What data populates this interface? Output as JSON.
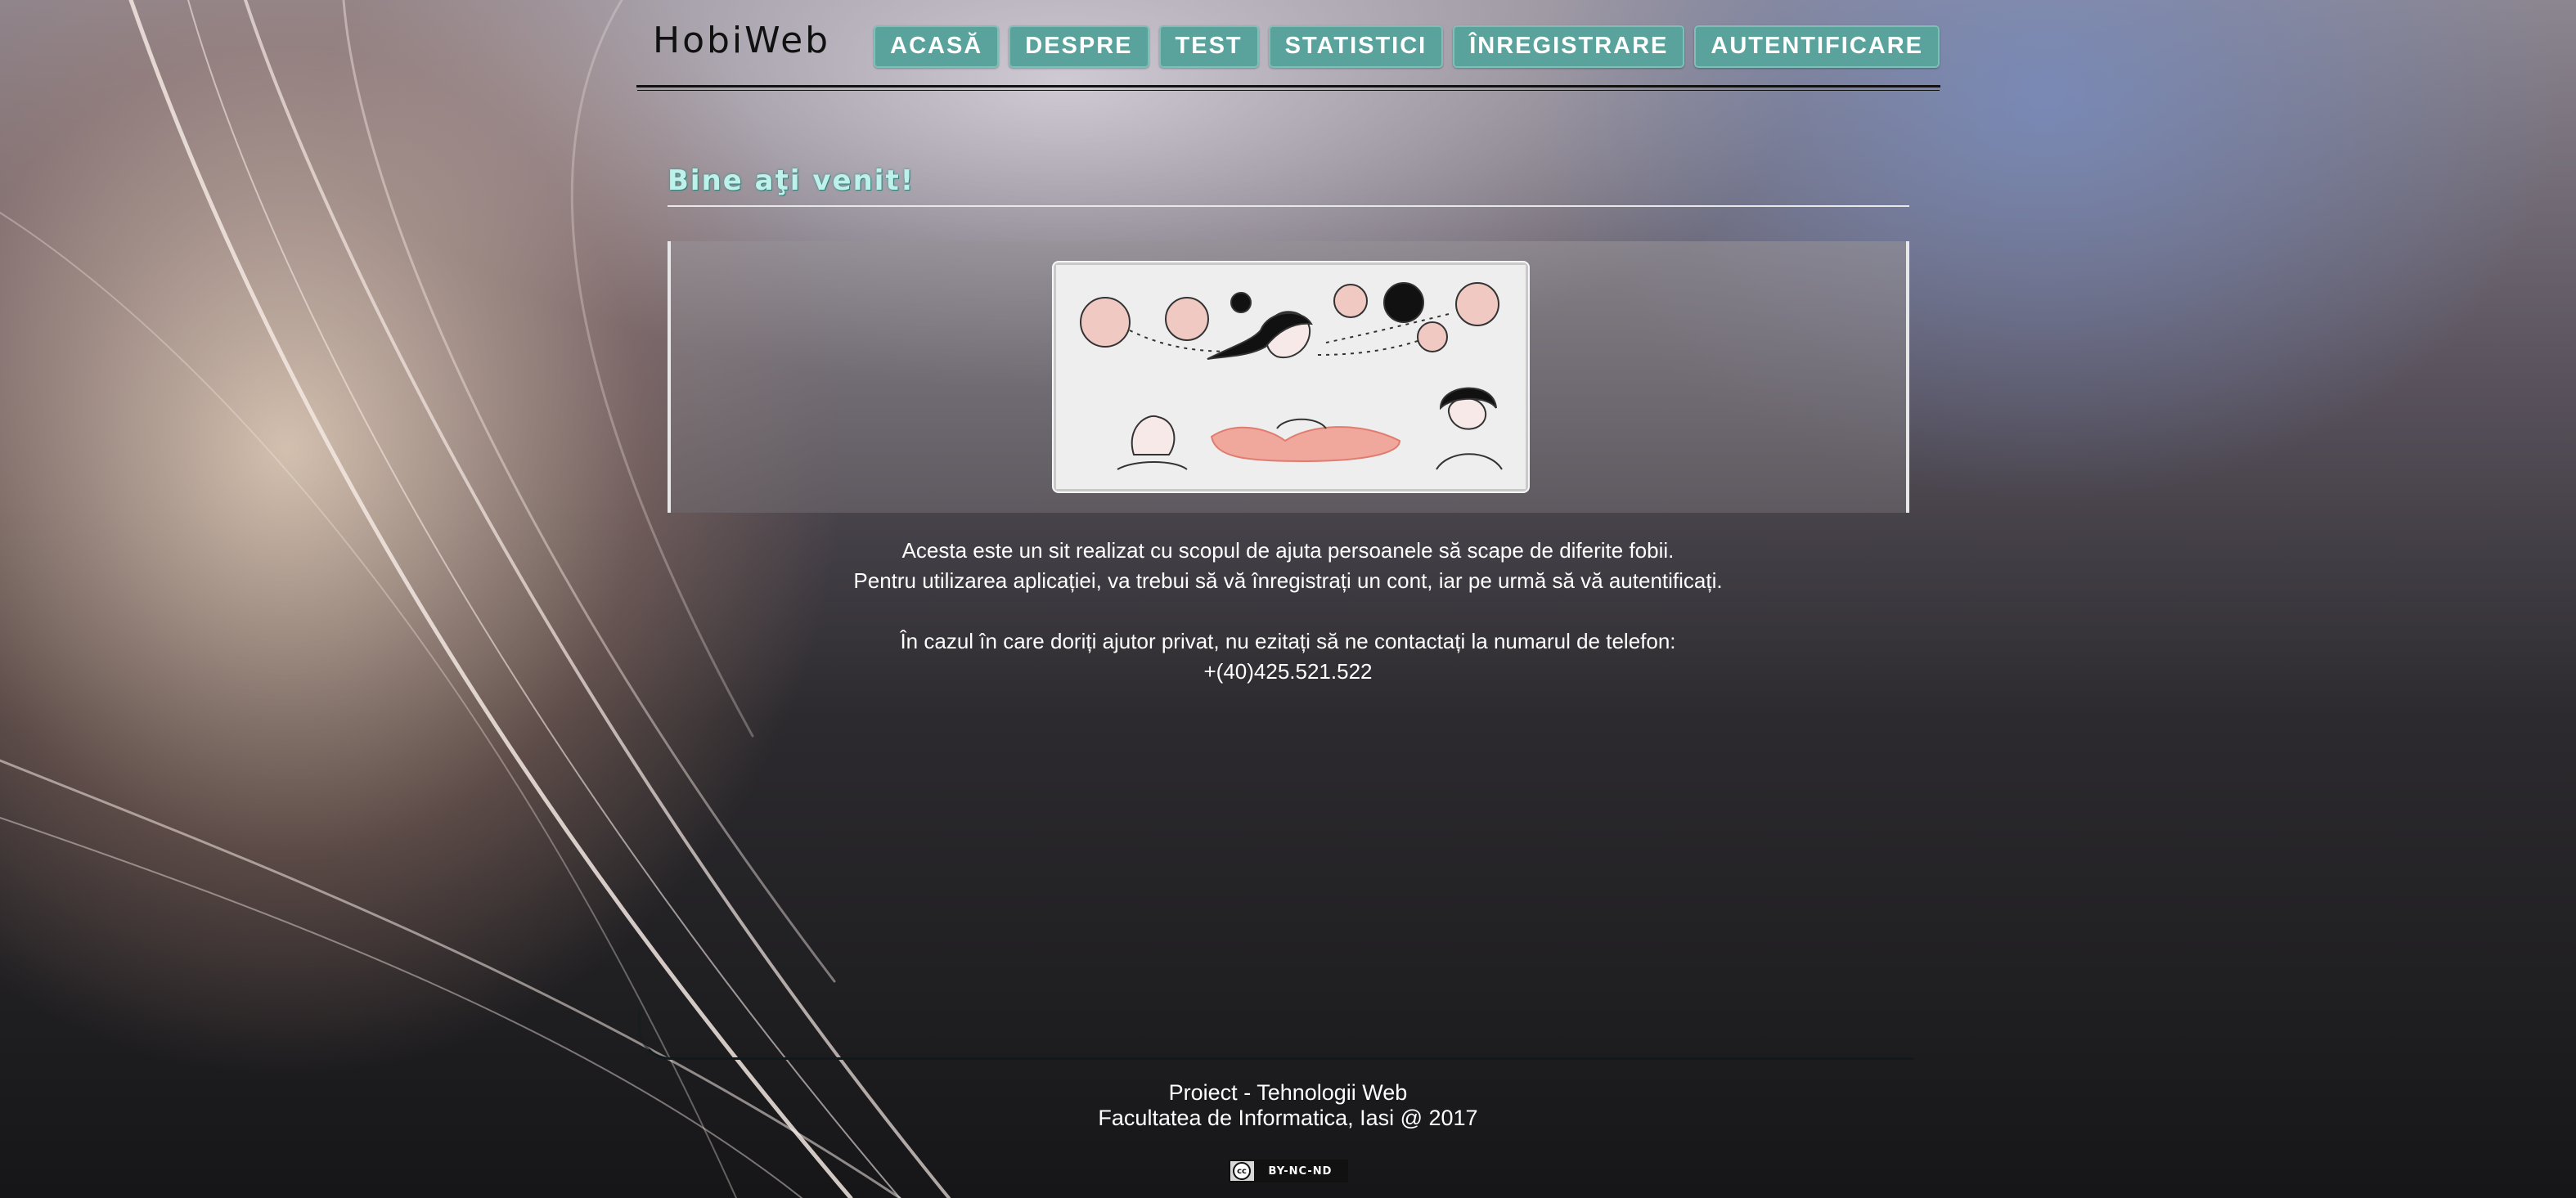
{
  "site": {
    "logo": "HobiWeb"
  },
  "nav": {
    "items": [
      {
        "label": "ACASĂ"
      },
      {
        "label": "DESPRE"
      },
      {
        "label": "TEST"
      },
      {
        "label": "STATISTICI"
      },
      {
        "label": "ÎNREGISTRARE"
      },
      {
        "label": "AUTENTIFICARE"
      }
    ]
  },
  "main": {
    "heading": "Bine aţi venit!",
    "intro_line1": "Acesta este un sit realizat cu scopul de ajuta persoanele să scape de diferite fobii.",
    "intro_line2": "Pentru utilizarea aplicației, va trebui să vă înregistrați un cont, iar pe urmă să vă autentificați.",
    "contact_line": "În cazul în care doriți ajutor privat, nu ezitați să ne contactați la numarul de telefon:",
    "phone": "+(40)425.521.522"
  },
  "footer": {
    "line1": "Proiect - Tehnologii Web",
    "line2": "Facultatea de Informatica, Iasi @ 2017",
    "license_symbol": "cc",
    "license_label": "BY-NC-ND"
  },
  "colors": {
    "nav_button": "#5aa39c",
    "heading": "#bdf1ea"
  }
}
